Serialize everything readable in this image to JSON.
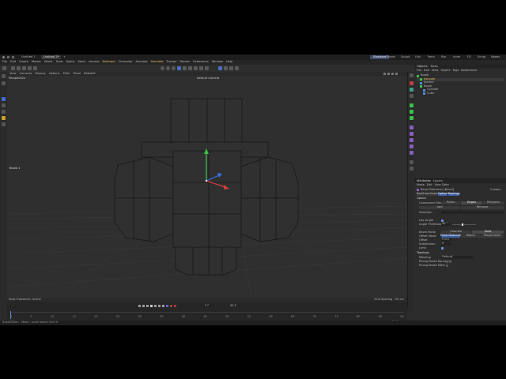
{
  "titlebar": {
    "tabs": [
      "Untitled 1",
      "Untitled 2*"
    ],
    "layouts": [
      "Standard",
      "Model",
      "Sculpt",
      "UVs",
      "Paint",
      "Rig",
      "Anim",
      "FX",
      "Script",
      "Nodes"
    ]
  },
  "menubar": [
    "File",
    "Edit",
    "Create",
    "Modes",
    "Select",
    "Tools",
    "Spline",
    "Mesh",
    "Volume",
    "MoGraph",
    "Character",
    "Animate",
    "Simulate",
    "Tracker",
    "Render",
    "Extensions",
    "Window",
    "Help"
  ],
  "viewport": {
    "menu": [
      "View",
      "Cameras",
      "Display",
      "Options",
      "Filter",
      "Panel",
      "Redshift"
    ],
    "label_left": "Perspective",
    "camera": "Default Camera",
    "object_label": "Boole.1",
    "footer_left": "View Transform: Scene",
    "footer_right": "Grid Spacing : 50 cm"
  },
  "timeline": {
    "frame_current": "0 F",
    "frame_end": "90 F",
    "frame_start_field": "0 F",
    "frame_end_field": "90 F",
    "ticks": [
      "0",
      "5",
      "10",
      "15",
      "20",
      "25",
      "30",
      "35",
      "40",
      "45",
      "50",
      "55",
      "60",
      "65",
      "70",
      "75",
      "80",
      "85",
      "90"
    ]
  },
  "status": {
    "text": "Subdivision : Mesh : scroll bevel Ctrl+V"
  },
  "objects": {
    "tabs": [
      "Objects",
      "Takes"
    ],
    "menu": [
      "File",
      "Edit",
      "View",
      "Object",
      "Tags",
      "Bookmarks"
    ],
    "items": [
      "Boole",
      "Extrude",
      "Sphere",
      "Boole",
      "Cylinder",
      "Cube"
    ]
  },
  "attributes": {
    "tabs": [
      "Attributes",
      "Layers"
    ],
    "menu": [
      "Mode",
      "Edit",
      "User Data"
    ],
    "object_title": "Bevel Deformer [Bevel]",
    "custom_label": "Custom",
    "subtabs": [
      "Basic",
      "Coordinates",
      "Option",
      "Topology"
    ],
    "section_option": "Option",
    "component_mode_label": "Component Mode",
    "component_modes": [
      "Points",
      "Edges",
      "Polygons"
    ],
    "add_btn": "Add",
    "remove_btn": "Remove",
    "selection_label": "Selection",
    "use_angle_label": "Use Angle",
    "angle_threshold_label": "Angle Threshold",
    "angle_threshold_value": "40 °",
    "bevel_mode_label": "Bevel Mode",
    "bevel_modes": [
      "Chamfer",
      "Solid"
    ],
    "offset_mode_label": "Offset Mode",
    "offset_modes": [
      "Fixed Distance",
      "Radial",
      "Proportional"
    ],
    "offset_label": "Offset",
    "offset_value": "5 cm",
    "subdivision_label": "Subdivision",
    "subdivision_value": "0",
    "limit_label": "Limit",
    "section_topology": "Topology",
    "mitering_label": "Mitering",
    "mitering_value": "Default",
    "phong_label": "Phong Break Rounding",
    "phong_miter_label": "Phong Break Miter"
  },
  "colors": {
    "accent": "#3f5fa8",
    "axis_y": "#3ec04a",
    "axis_x": "#d23c3c",
    "axis_z": "#3a6fe0",
    "wire": "#161616"
  }
}
